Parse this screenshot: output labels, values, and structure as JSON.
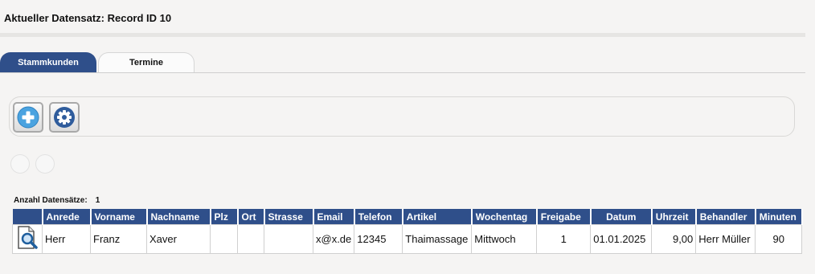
{
  "record": {
    "title": "Aktueller Datensatz: Record ID 10"
  },
  "tabs": [
    {
      "label": "Stammkunden",
      "active": true
    },
    {
      "label": "Termine",
      "active": false
    }
  ],
  "toolbar": {
    "add_icon": "plus-circle-icon",
    "settings_icon": "gear-icon"
  },
  "count": {
    "label": "Anzahl Datensätze:",
    "value": "1"
  },
  "table": {
    "columns": [
      "",
      "Anrede",
      "Vorname",
      "Nachname",
      "Plz",
      "Ort",
      "Strasse",
      "Email",
      "Telefon",
      "Artikel",
      "Wochentag",
      "Freigabe",
      "Datum",
      "Uhrzeit",
      "Behandler",
      "Minuten"
    ],
    "rows": [
      {
        "icon": "document-search-icon",
        "cells": [
          "Herr",
          "Franz",
          "Xaver",
          "",
          "",
          "",
          "x@x.de",
          "12345",
          "Thaimassage",
          "Mittwoch",
          "1",
          "01.01.2025",
          "9,00",
          "Herr Müller",
          "90"
        ]
      }
    ]
  },
  "colors": {
    "accent": "#2f4f8a",
    "background": "#f5f4f3",
    "add_icon": "#4aa3e0",
    "settings_icon": "#2f5c9c"
  }
}
